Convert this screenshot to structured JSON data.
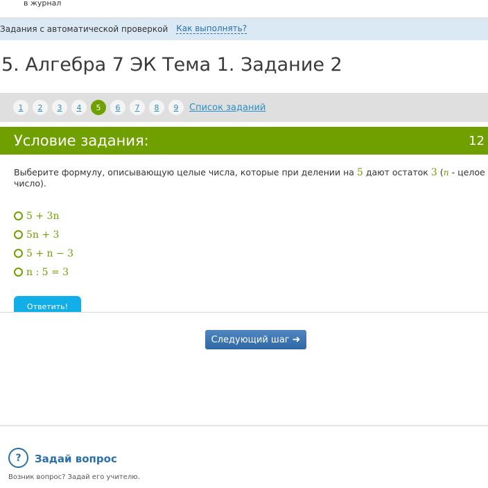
{
  "top": {
    "journal_link": "в журнал"
  },
  "info_bar": {
    "label": "Задания с автоматической проверкой",
    "help_link": "Как выполнять?"
  },
  "page_title": "5. Алгебра 7 ЭК Тема 1. Задание 2",
  "steps": {
    "items": [
      "1",
      "2",
      "3",
      "4",
      "5",
      "6",
      "7",
      "8",
      "9"
    ],
    "active": "5",
    "task_list_link": "Список заданий"
  },
  "task": {
    "header_title": "Условие задания:",
    "points": "12",
    "question_prefix": "Выберите формулу, описывающую целые числа, которые при делении на",
    "divisor": "5",
    "question_mid": "дают остаток",
    "remainder": "3",
    "open_paren": "(",
    "var": "n",
    "question_suffix": "- целое число).",
    "options": [
      "5 + 3n",
      "5n + 3",
      "5 + n − 3",
      "n : 5 = 3"
    ],
    "answer_button": "Ответить!"
  },
  "next_button": "Следующий шаг",
  "ask": {
    "icon_text": "?",
    "title": "Задай вопрос",
    "subtitle": "Возник вопрос? Задай его учителю."
  },
  "colors": {
    "accent_green": "#6fa000",
    "link_blue": "#2a8fc4",
    "answer_button": "#12aee8",
    "next_button": "#3a74b2",
    "info_bar_bg": "#dbe9f4"
  }
}
